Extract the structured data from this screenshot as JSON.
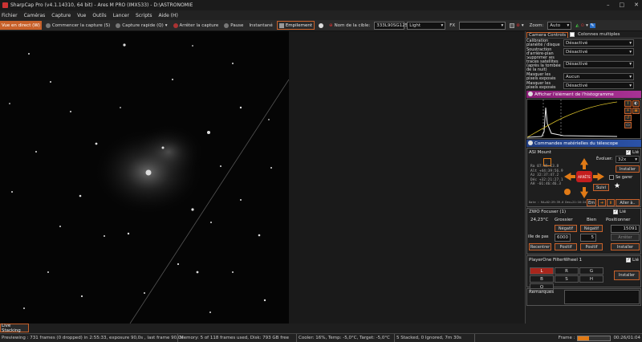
{
  "window": {
    "title": "SharpCap Pro (v4.1.14310, 64 bit) - Ares M PRO (IMX533) - D:\\ASTRONOMIE"
  },
  "menu": [
    "Fichier",
    "Caméras",
    "Capture",
    "Vue",
    "Outils",
    "Lancer",
    "Scripts",
    "Aide (H)"
  ],
  "toolbar": {
    "live_view": "Vue en direct (W)",
    "start_capture": "Commencer la capture (S)",
    "quick_capture": "Capture rapide (Q)",
    "stop_capture": "Arrêter la capture",
    "pause": "Pause",
    "snapshot": "Instantané",
    "stacking": "Empilement",
    "target_label": "Nom de la cible:",
    "target_value": "333L90SG125",
    "frame_type": "Light",
    "fx_label": "FX",
    "zoom_label": "Zoom:",
    "zoom_value": "Auto"
  },
  "panel": {
    "tab_camera": "Camera Controls",
    "tab_multi": "Colonnes multiples",
    "rows": [
      {
        "label": "Calibration planéité / disque",
        "value": "Désactivé"
      },
      {
        "label": "Soustraction d'arrière-plan",
        "value": "Désactivé"
      },
      {
        "label": "Supprimer les traces satellites (après la tombée de la nuit)",
        "value": "Désactivé"
      },
      {
        "label": "Masquer les pixels exposés",
        "value": "Aucun"
      },
      {
        "label": "Masquer les pixels exposés",
        "value": "Désactivé"
      }
    ],
    "histogram_title": "Afficher l'élément de l'histogramme",
    "telescope_title": "Commandes matérielles du télescope",
    "mount": {
      "name": "ASI Mount",
      "linked": "Lié",
      "evolve_label": "Évoluer:",
      "evolve_value": "32x",
      "install": "Installer",
      "park_label": "Se garer",
      "goto_label": "Suivi",
      "allign": "Aller à..",
      "stop_center": "ARRÊTE",
      "coords": [
        "Ra    07:45:13.8",
        "Alt  +44:39:56.9",
        "Az   32:37:47.2",
        "Déc  +32:21:27.1",
        "AH   -01:46:46.3"
      ],
      "stamp": "Date : RA+02:29:39.0 Dec+21:16:24",
      "em": "Em"
    },
    "focuser": {
      "name": "ZWO Focuser (1)",
      "linked": "Lié",
      "temp": "24,23°C",
      "coarse": "Grossier",
      "fine": "Bien",
      "position_label": "Positionner",
      "position_value": "15091",
      "neg1": "Négatif",
      "neg2": "Négatif",
      "step_label": "ille de pas",
      "step_value": "6000",
      "step2": "5",
      "stop": "Arrêter",
      "recenter": "Recentrer",
      "pos1": "Positif",
      "pos2": "Positif",
      "install": "Installer"
    },
    "filterwheel": {
      "name": "PlayerOne FilterWheel 1",
      "linked": "Lié",
      "filters": [
        "L",
        "R",
        "G",
        "B",
        "S",
        "H",
        "O",
        "",
        ""
      ],
      "selected": "L",
      "install": "Installer"
    },
    "remarks": "Remarques"
  },
  "status": {
    "preview": "Previewing : 731 frames (0 dropped) in 2:55:33, exposure 90,0s , last frame 90,0s",
    "memory": "Memory: 5 of 118 frames used, Disk: 793 GB free",
    "cooler": "Cooler: 16%, Temp: -5,0°C, Target: -5,0°C",
    "stacked": "5 Stacked, 0 Ignored, 7m 30s",
    "frame_label": "Frame :",
    "frame_progress": 0.35,
    "elapsed": "00:26/01:04"
  },
  "live_stacking": "Live Stacking",
  "colors": {
    "accent": "#c8612a",
    "histogram_header": "#8a1d75",
    "telescope_header": "#1f3c80",
    "filter_selected": "#a8261c"
  }
}
